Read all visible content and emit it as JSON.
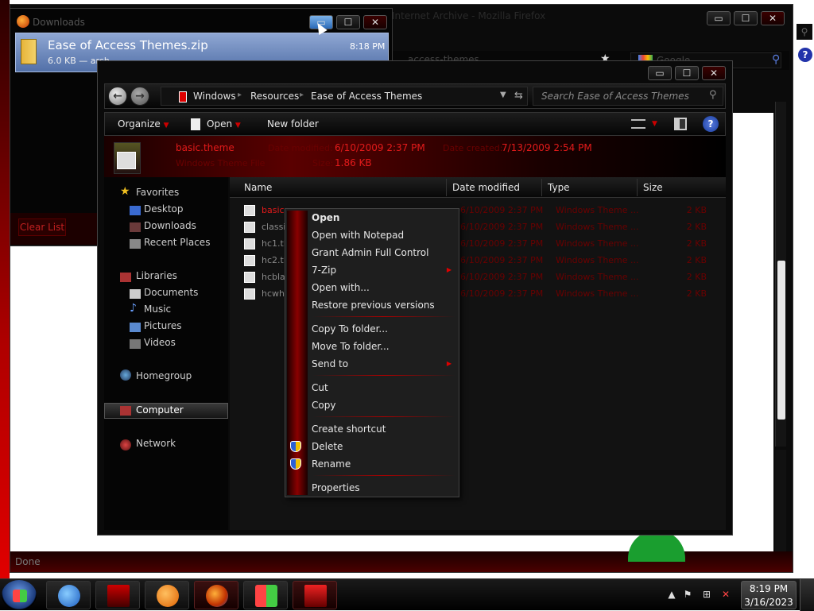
{
  "firefox": {
    "title": "Internet Archive - Mozilla Firefox",
    "url_text": "access-themes",
    "search_placeholder": "Google",
    "status": "Done",
    "min_label": "▭",
    "max_label": "☐",
    "close_label": "✕"
  },
  "downloads": {
    "title": "Downloads",
    "item": {
      "filename": "Ease of Access Themes.zip",
      "size_text": "6.0 KB — arch",
      "time": "8:18 PM"
    },
    "clear_list": "Clear List"
  },
  "explorer": {
    "breadcrumbs": [
      "Windows",
      "Resources",
      "Ease of Access Themes"
    ],
    "search_placeholder": "Search Ease of Access Themes",
    "commands": {
      "organize": "Organize",
      "open": "Open",
      "new_folder": "New folder"
    },
    "details": {
      "name": "basic.theme",
      "date_modified_label": "Date modified:",
      "date_modified": "6/10/2009 2:37 PM",
      "date_created_label": "Date created:",
      "date_created": "7/13/2009 2:54 PM",
      "type": "Windows Theme File",
      "size_label": "Size:",
      "size": "1.86 KB"
    },
    "nav": {
      "favorites": "Favorites",
      "desktop": "Desktop",
      "downloads": "Downloads",
      "recent_places": "Recent Places",
      "libraries": "Libraries",
      "documents": "Documents",
      "music": "Music",
      "pictures": "Pictures",
      "videos": "Videos",
      "homegroup": "Homegroup",
      "computer": "Computer",
      "network": "Network"
    },
    "columns": {
      "name": "Name",
      "date_modified": "Date modified",
      "type": "Type",
      "size": "Size"
    },
    "files": [
      {
        "name": "basic.",
        "date": "6/10/2009 2:37 PM",
        "type": "Windows Theme ...",
        "size": "2 KB"
      },
      {
        "name": "classi",
        "date": "6/10/2009 2:37 PM",
        "type": "Windows Theme ...",
        "size": "2 KB"
      },
      {
        "name": "hc1.tl",
        "date": "6/10/2009 2:37 PM",
        "type": "Windows Theme ...",
        "size": "2 KB"
      },
      {
        "name": "hc2.tl",
        "date": "6/10/2009 2:37 PM",
        "type": "Windows Theme ...",
        "size": "2 KB"
      },
      {
        "name": "hcbla",
        "date": "6/10/2009 2:37 PM",
        "type": "Windows Theme ...",
        "size": "2 KB"
      },
      {
        "name": "hcwh",
        "date": "6/10/2009 2:37 PM",
        "type": "Windows Theme ...",
        "size": "2 KB"
      }
    ]
  },
  "context_menu": {
    "open": "Open",
    "open_with_notepad": "Open with Notepad",
    "grant_admin": "Grant Admin Full Control",
    "seven_zip": "7-Zip",
    "open_with": "Open with...",
    "restore": "Restore previous versions",
    "copy_to": "Copy To folder...",
    "move_to": "Move To folder...",
    "send_to": "Send to",
    "cut": "Cut",
    "copy": "Copy",
    "create_shortcut": "Create shortcut",
    "delete": "Delete",
    "rename": "Rename",
    "properties": "Properties"
  },
  "taskbar": {
    "time": "8:19 PM",
    "date": "3/16/2023"
  },
  "colors": {
    "accent_red": "#e31a1a",
    "dark_red": "#6a0000",
    "selection_blue": "#5270a8"
  }
}
